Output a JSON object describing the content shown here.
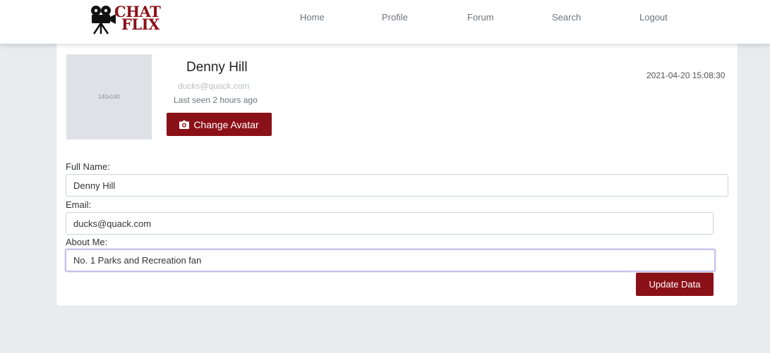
{
  "header": {
    "logo": {
      "line1": "CHAT",
      "line2": "FLIX"
    },
    "nav": [
      {
        "label": "Home"
      },
      {
        "label": "Profile"
      },
      {
        "label": "Forum"
      },
      {
        "label": "Search"
      },
      {
        "label": "Logout"
      }
    ]
  },
  "profile": {
    "avatar_placeholder": "140x140",
    "name": "Denny Hill",
    "email": "ducks@quack.com",
    "last_seen": "Last seen 2 hours ago",
    "change_avatar_label": "Change Avatar",
    "timestamp": "2021-04-20 15:08:30"
  },
  "form": {
    "full_name": {
      "label": "Full Name:",
      "value": "Denny Hill"
    },
    "email": {
      "label": "Email:",
      "value": "ducks@quack.com"
    },
    "about": {
      "label": "About Me:",
      "value": "No. 1 Parks and Recreation fan"
    },
    "submit_label": "Update Data"
  },
  "colors": {
    "brand": "#8b1118",
    "background": "#e9ecef",
    "focus_border": "#c5c3ec"
  },
  "icons": {
    "logo": "film-camera-icon",
    "change_avatar": "camera-icon"
  }
}
